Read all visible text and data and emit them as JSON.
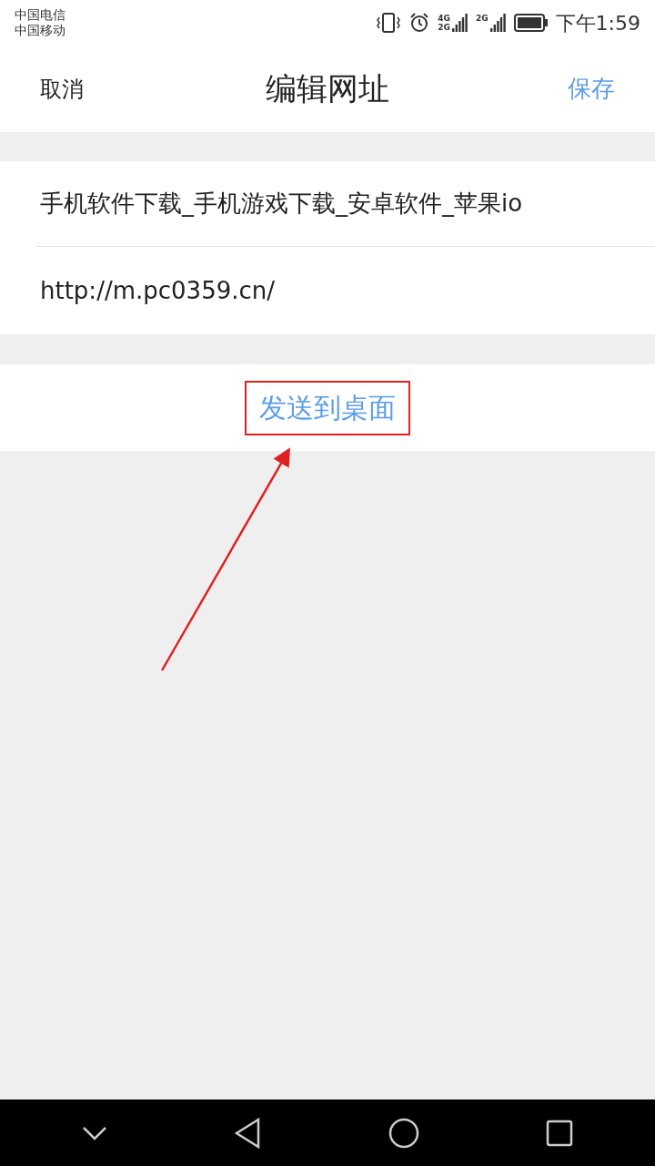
{
  "status_bar": {
    "carriers": [
      "中国电信",
      "中国移动"
    ],
    "networks": [
      "4G",
      "2G",
      "2G"
    ],
    "time": "下午1:59"
  },
  "header": {
    "cancel": "取消",
    "title": "编辑网址",
    "save": "保存"
  },
  "form": {
    "name": "手机软件下载_手机游戏下载_安卓软件_苹果io",
    "url": "http://m.pc0359.cn/"
  },
  "send_button": {
    "label": "发送到桌面",
    "highlighted": true
  }
}
